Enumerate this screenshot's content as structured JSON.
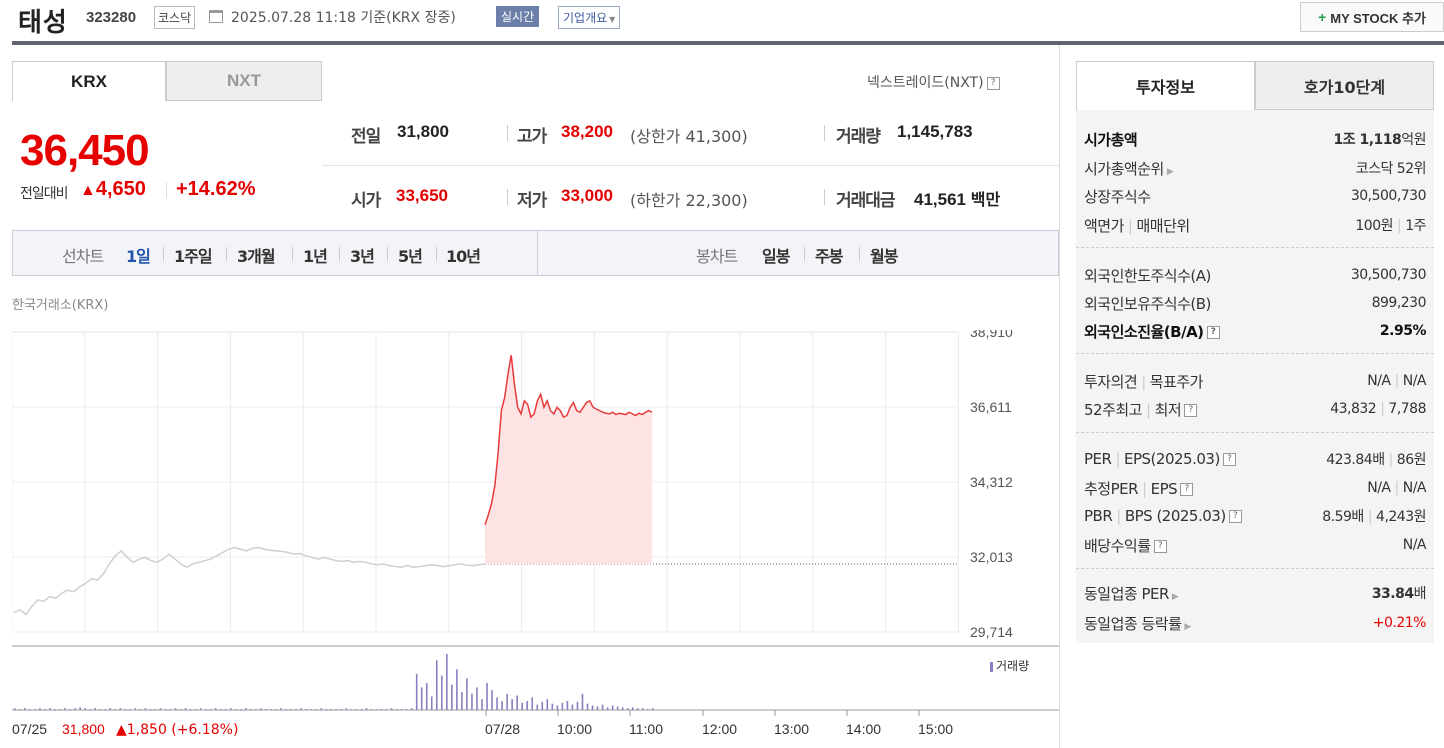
{
  "header": {
    "stock_name": "태성",
    "stock_code": "323280",
    "market": "코스닥",
    "datetime": "2025.07.28 11:18 기준(KRX 장중)",
    "realtime_label": "실시간",
    "overview_label": "기업개요",
    "mystock_label": "MY STOCK 추가"
  },
  "tabs": {
    "krx": "KRX",
    "nxt": "NXT",
    "nxt_link": "넥스트레이드(NXT)"
  },
  "quote": {
    "price": "36,450",
    "change_label": "전일대비",
    "change_value": "4,650",
    "change_pct": "+14.62%",
    "prev_close_label": "전일",
    "prev_close": "31,800",
    "high_label": "고가",
    "high": "38,200",
    "upper_limit_label": "(상한가",
    "upper_limit": "41,300)",
    "volume_label": "거래량",
    "volume": "1,145,783",
    "open_label": "시가",
    "open": "33,650",
    "low_label": "저가",
    "low": "33,000",
    "lower_limit_label": "(하한가",
    "lower_limit": "22,300)",
    "amount_label": "거래대금",
    "amount": "41,561",
    "amount_unit": "백만"
  },
  "period_bar": {
    "line_label": "선차트",
    "periods": [
      "1일",
      "1주일",
      "3개월",
      "1년",
      "3년",
      "5년",
      "10년"
    ],
    "candle_label": "봉차트",
    "candles": [
      "일봉",
      "주봉",
      "월봉"
    ]
  },
  "exchange_label": "한국거래소(KRX)",
  "volume_legend": "거래량",
  "right_panel": {
    "tab_invest": "투자정보",
    "tab_orderbook": "호가10단계",
    "market_cap_label": "시가총액",
    "market_cap_value": "1조 1,118",
    "market_cap_unit": "억원",
    "cap_rank_label": "시가총액순위",
    "cap_rank_value": "코스닥 52위",
    "shares_label": "상장주식수",
    "shares_value": "30,500,730",
    "par_label": "액면가",
    "trade_unit_label": "매매단위",
    "par_value": "100원",
    "trade_unit_value": "1주",
    "foreign_limit_label": "외국인한도주식수(A)",
    "foreign_limit_value": "30,500,730",
    "foreign_hold_label": "외국인보유주식수(B)",
    "foreign_hold_value": "899,230",
    "foreign_ratio_label": "외국인소진율(B/A)",
    "foreign_ratio_value": "2.95%",
    "opinion_label": "투자의견",
    "target_label": "목표주가",
    "opinion_value": "N/A",
    "target_value": "N/A",
    "w52_high_label": "52주최고",
    "w52_low_label": "최저",
    "w52_high_value": "43,832",
    "w52_low_value": "7,788",
    "per_label": "PER",
    "eps_label": "EPS(2025.03)",
    "per_value": "423.84배",
    "eps_value": "86원",
    "est_per_label": "추정PER",
    "est_eps_label": "EPS",
    "est_per_value": "N/A",
    "est_eps_value": "N/A",
    "pbr_label": "PBR",
    "bps_label": "BPS (2025.03)",
    "pbr_value": "8.59배",
    "bps_value": "4,243원",
    "div_label": "배당수익률",
    "div_value": "N/A",
    "ind_per_label": "동일업종 PER",
    "ind_per_value": "33.84",
    "ind_per_unit": "배",
    "ind_chg_label": "동일업종 등락률",
    "ind_chg_value": "+0.21%"
  },
  "chart_data": {
    "type": "line",
    "y_ticks": [
      "38,910",
      "36,611",
      "34,312",
      "32,013",
      "29,714"
    ],
    "ylim": [
      29714,
      38910
    ],
    "reference_line": 31800,
    "x_labels": [
      "07/25",
      "07/28",
      "10:00",
      "11:00",
      "12:00",
      "13:00",
      "14:00",
      "15:00"
    ],
    "prev_day_label": "07/25",
    "prev_day_close": "31,800",
    "prev_day_change": "1,850",
    "prev_day_pct": "(+6.18%)",
    "series": [
      {
        "values": [
          30300,
          30400,
          30250,
          30500,
          30700,
          30650,
          30800,
          30750,
          30900,
          31000,
          30950,
          31100,
          31200,
          31350,
          31300,
          31500,
          31800,
          32050,
          32200,
          32000,
          31850,
          31950,
          32000,
          31900,
          31850,
          31950,
          32100,
          31950,
          31800,
          31700,
          31800,
          31850,
          31900,
          31950,
          32050,
          32150,
          32250,
          32300,
          32250,
          32200,
          32280,
          32300,
          32250,
          32220,
          32200,
          32180,
          32150,
          32100,
          32120,
          32050,
          32000,
          31950,
          32000,
          31950,
          31900,
          31880,
          31900,
          31850,
          31880,
          31850,
          31800,
          31780,
          31800,
          31750,
          31720,
          31700,
          31750,
          31700,
          31720,
          31750,
          31780,
          31750,
          31720,
          31750,
          31780,
          31800,
          31760,
          31750,
          31780,
          31800
        ]
      },
      {
        "values": [
          33000,
          33300,
          33650,
          34200,
          35200,
          36500,
          36900,
          37600,
          38200,
          37300,
          36600,
          36400,
          36800,
          36700,
          36300,
          36400,
          36800,
          37000,
          36600,
          36800,
          36500,
          36400,
          36600,
          36500,
          36300,
          36350,
          36600,
          36750,
          36500,
          36450,
          36600,
          36750,
          36800,
          36600,
          36550,
          36500,
          36450,
          36420,
          36400,
          36450,
          36380,
          36420,
          36400,
          36380,
          36450,
          36400,
          36350,
          36420,
          36380,
          36450,
          36500,
          36450
        ]
      }
    ],
    "volume": [
      2,
      1,
      2,
      1,
      1,
      2,
      1,
      2,
      1,
      1,
      2,
      1,
      2,
      3,
      2,
      1,
      2,
      1,
      1,
      2,
      1,
      2,
      1,
      1,
      2,
      1,
      2,
      1,
      1,
      2,
      1,
      1,
      2,
      1,
      2,
      1,
      1,
      2,
      1,
      1,
      2,
      1,
      1,
      2,
      1,
      1,
      2,
      1,
      1,
      2,
      1,
      1,
      1,
      2,
      1,
      1,
      1,
      2,
      1,
      1,
      1,
      2,
      1,
      1,
      1,
      1,
      2,
      1,
      1,
      1,
      2,
      1,
      1,
      1,
      1,
      2,
      1,
      1,
      1,
      2,
      40,
      25,
      30,
      15,
      55,
      38,
      62,
      28,
      45,
      20,
      35,
      18,
      25,
      12,
      30,
      22,
      14,
      10,
      18,
      12,
      16,
      8,
      10,
      14,
      6,
      9,
      12,
      7,
      5,
      8,
      10,
      6,
      9,
      18,
      7,
      5,
      4,
      6,
      3,
      5,
      4,
      3,
      2,
      3,
      2,
      2,
      1,
      2
    ]
  }
}
